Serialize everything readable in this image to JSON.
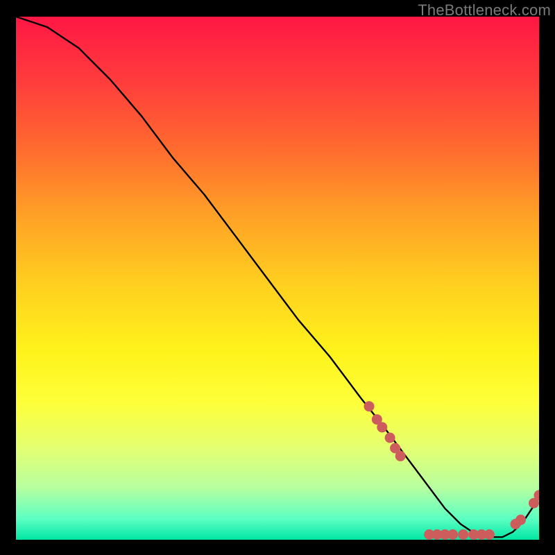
{
  "watermark": "TheBottleneck.com",
  "colors": {
    "curve": "#000000",
    "marker_fill": "#cd5c5c",
    "marker_stroke": "#cd5c5c"
  },
  "chart_data": {
    "type": "line",
    "title": "",
    "xlabel": "",
    "ylabel": "",
    "xlim": [
      0,
      100
    ],
    "ylim": [
      0,
      100
    ],
    "curve": {
      "x": [
        0,
        3,
        6,
        9,
        12,
        15,
        18,
        24,
        30,
        36,
        42,
        48,
        54,
        60,
        66,
        70,
        73,
        76,
        79,
        82,
        85,
        88,
        91,
        93,
        95,
        97,
        100
      ],
      "y": [
        100,
        99,
        98,
        96,
        94,
        91,
        88,
        81,
        73,
        66,
        58,
        50,
        42,
        35,
        27,
        22,
        18,
        14,
        10,
        6,
        3,
        1,
        0.5,
        0.5,
        1.5,
        3.5,
        8
      ]
    },
    "markers": [
      {
        "x": 67.5,
        "y": 25.5
      },
      {
        "x": 69.0,
        "y": 23.0
      },
      {
        "x": 70.0,
        "y": 21.5
      },
      {
        "x": 71.5,
        "y": 19.5
      },
      {
        "x": 72.5,
        "y": 17.5
      },
      {
        "x": 73.5,
        "y": 16.0
      },
      {
        "x": 79.0,
        "y": 1.0
      },
      {
        "x": 80.5,
        "y": 1.0
      },
      {
        "x": 82.0,
        "y": 1.0
      },
      {
        "x": 83.5,
        "y": 1.0
      },
      {
        "x": 85.5,
        "y": 1.0
      },
      {
        "x": 87.5,
        "y": 1.0
      },
      {
        "x": 89.0,
        "y": 1.0
      },
      {
        "x": 90.5,
        "y": 1.0
      },
      {
        "x": 95.5,
        "y": 3.0
      },
      {
        "x": 96.5,
        "y": 3.8
      },
      {
        "x": 99.0,
        "y": 7.0
      },
      {
        "x": 100.0,
        "y": 8.5
      }
    ]
  }
}
